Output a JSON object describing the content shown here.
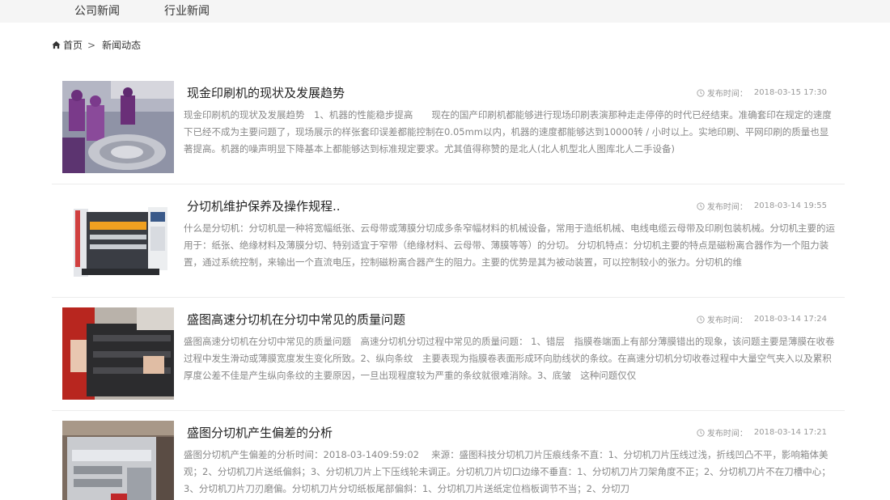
{
  "nav": {
    "tabs": [
      {
        "label": "公司新闻"
      },
      {
        "label": "行业新闻"
      }
    ]
  },
  "breadcrumb": {
    "home": "首页",
    "separator": ">",
    "current": "新闻动态"
  },
  "meta_label": "发布时间：",
  "articles": [
    {
      "title": "现金印刷机的现状及发展趋势",
      "date": "2018-03-15 17:30",
      "summary": "现金印刷机的现状及发展趋势　1、机器的性能稳步提高　　现在的国产印刷机都能够进行现场印刷表演那种走走停停的时代已经结束。准确套印在规定的速度下已经不成为主要问题了，现场展示的样张套印误差都能控制在0.05mm以内，机器的速度都能够达到10000转 / 小时以上。实地印刷、平网印刷的质量也显著提高。机器的噪声明显下降基本上都能够达到标准规定要求。尤其值得称赞的是北人(北人机型北人图库北人二手设备)"
    },
    {
      "title": "分切机维护保养及操作规程..",
      "date": "2018-03-14 19:55",
      "summary": "什么是分切机：分切机是一种将宽幅纸张、云母带或薄膜分切成多条窄幅材料的机械设备，常用于造纸机械、电线电缆云母带及印刷包装机械。分切机主要的运用于：纸张、绝缘材料及薄膜分切、特别适宜于窄带（绝缘材料、云母带、薄膜等等）的分切。 分切机特点：分切机主要的特点是磁粉离合器作为一个阻力装置，通过系统控制，来输出一个直流电压，控制磁粉离合器产生的阻力。主要的优势是其为被动装置，可以控制较小的张力。分切机的维"
    },
    {
      "title": "盛图高速分切机在分切中常见的质量问题",
      "date": "2018-03-14 17:24",
      "summary": "盛图高速分切机在分切中常见的质量问题　高速分切机分切过程中常见的质量问题： 1、错层　指膜卷端面上有部分薄膜错出的现象，该问题主要是薄膜在收卷过程中发生滑动或薄膜宽度发生变化所致。2、纵向条纹　主要表现为指膜卷表面形成环向肋线状的条纹。在高速分切机分切收卷过程中大量空气夹入以及累积厚度公差不佳是产生纵向条纹的主要原因，一旦出现程度较为严重的条纹就很难消除。3、底皱　这种问题仅仅"
    },
    {
      "title": "盛图分切机产生偏差的分析",
      "date": "2018-03-14 17:21",
      "summary": "盛图分切机产生偏差的分析时间：2018-03-1409:59:02　 来源：盛图科技分切机刀片压痕线条不直：1、分切机刀片压线过浅，折线凹凸不平，影响箱体美观；2、分切机刀片送纸偏斜；3、分切机刀片上下压线轮未调正。分切机刀片切口边缘不垂直：1、分切机刀片刀架角度不正；2、分切机刀片不在刀槽中心；3、分切机刀片刀刃磨偏。分切机刀片分切纸板尾部偏斜：1、分切机刀片送纸定位档板调节不当；2、分切刀"
    }
  ]
}
